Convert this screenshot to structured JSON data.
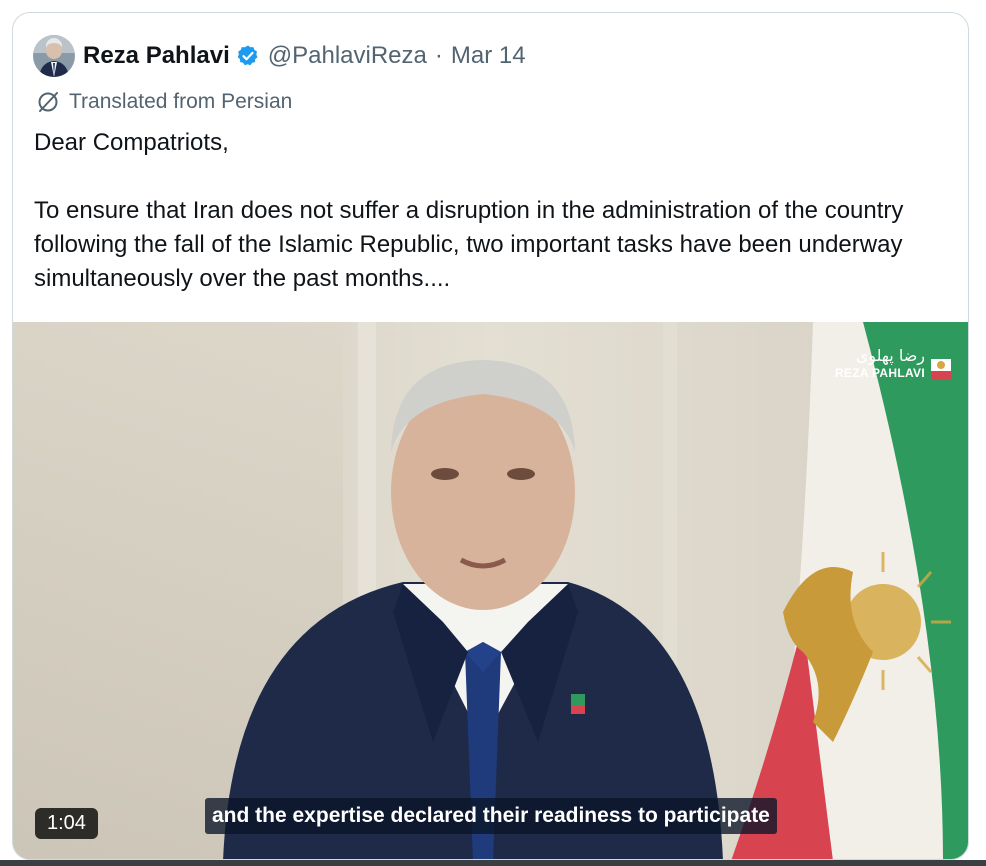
{
  "tweet": {
    "author_name": "Reza Pahlavi",
    "handle": "@PahlaviReza",
    "separator": "·",
    "date": "Mar 14",
    "translated_label": "Translated from Persian",
    "greeting": "Dear Compatriots,",
    "body": "To ensure that Iran does not suffer a disruption in the administration of the country following the fall of the Islamic Republic, two important tasks have been underway simultaneously over the past months...."
  },
  "video": {
    "duration": "1:04",
    "subtitle": "and the expertise declared their readiness to participate",
    "watermark_persian": "رضا پهلوی",
    "watermark_latin": "REZA PAHLAVI"
  },
  "colors": {
    "verified_blue": "#1d9bf0",
    "text_primary": "#0f1419",
    "text_secondary": "#536471"
  },
  "icons": [
    "verified-badge-icon",
    "translate-icon",
    "avatar"
  ]
}
